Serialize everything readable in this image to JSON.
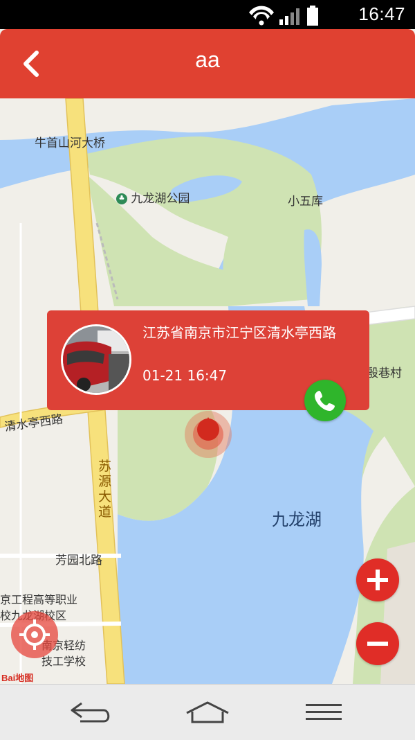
{
  "status_bar": {
    "time": "16:47",
    "icons": [
      "wifi-icon",
      "signal-icon",
      "battery-icon"
    ]
  },
  "header": {
    "title": "aa",
    "back_icon": "chevron-left-icon",
    "color": "#e04131"
  },
  "map": {
    "labels": {
      "bridge": "牛首山河大桥",
      "park": "九龙湖公园",
      "village_small": "小五库",
      "village_right": "殷巷村",
      "road_qingshuiting": "清水亭西路",
      "road_suyuan": "苏源大道",
      "road_fangyuan": "芳园北路",
      "lake": "九龙湖",
      "school1_line1": "南京工程高等职业",
      "school1_line2": "学校九龙湖校区",
      "school2_line1": "南京轻纺",
      "school2_line2": "技工学校",
      "logo": "Bai地图"
    }
  },
  "popup": {
    "address": "江苏省南京市江宁区清水亭西路",
    "time": "01-21 16:47",
    "call_icon": "phone-icon",
    "color": "#dd4137",
    "call_color": "#2fb52b"
  },
  "controls": {
    "zoom_in_icon": "plus-icon",
    "zoom_out_icon": "minus-icon",
    "locate_icon": "crosshair-icon"
  },
  "nav_bar": {
    "back_icon": "back-icon",
    "home_icon": "home-icon",
    "menu_icon": "menu-icon"
  }
}
